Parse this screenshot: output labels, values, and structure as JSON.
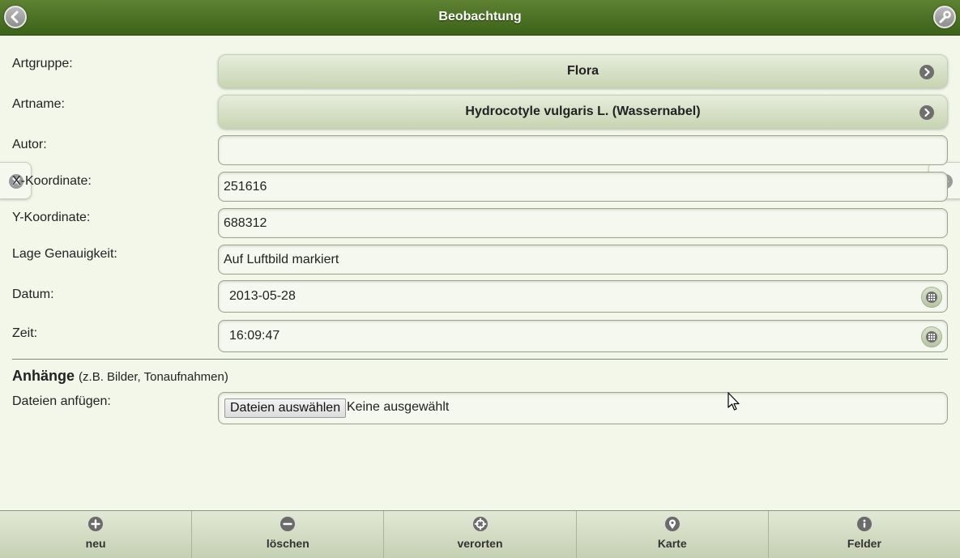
{
  "header": {
    "title": "Beobachtung",
    "back_icon": "back-icon",
    "tool_icon": "wrench-icon"
  },
  "form": {
    "artgruppe": {
      "label": "Artgruppe:",
      "value": "Flora"
    },
    "artname": {
      "label": "Artname:",
      "value": "Hydrocotyle vulgaris L. (Wassernabel)"
    },
    "autor": {
      "label": "Autor:",
      "value": ""
    },
    "x_koordinate": {
      "label": "X-Koordinate:",
      "value": "251616"
    },
    "y_koordinate": {
      "label": "Y-Koordinate:",
      "value": "688312"
    },
    "lage": {
      "label": "Lage Genauigkeit:",
      "value": "Auf Luftbild markiert"
    },
    "datum": {
      "label": "Datum:",
      "value": "2013-05-28"
    },
    "zeit": {
      "label": "Zeit:",
      "value": "16:09:47"
    }
  },
  "attachments": {
    "title": "Anhänge",
    "hint": "(z.B. Bilder, Tonaufnahmen)",
    "label": "Dateien anfügen:",
    "button": "Dateien auswählen",
    "status": "Keine ausgewählt"
  },
  "footer": {
    "items": [
      {
        "label": "neu",
        "icon": "plus-icon"
      },
      {
        "label": "löschen",
        "icon": "minus-icon"
      },
      {
        "label": "verorten",
        "icon": "crosshair-icon"
      },
      {
        "label": "Karte",
        "icon": "map-pin-icon"
      },
      {
        "label": "Felder",
        "icon": "info-icon"
      }
    ]
  },
  "colors": {
    "header": "#4a7024",
    "background": "#f2f7ea",
    "footer": "#d4dcc4"
  }
}
